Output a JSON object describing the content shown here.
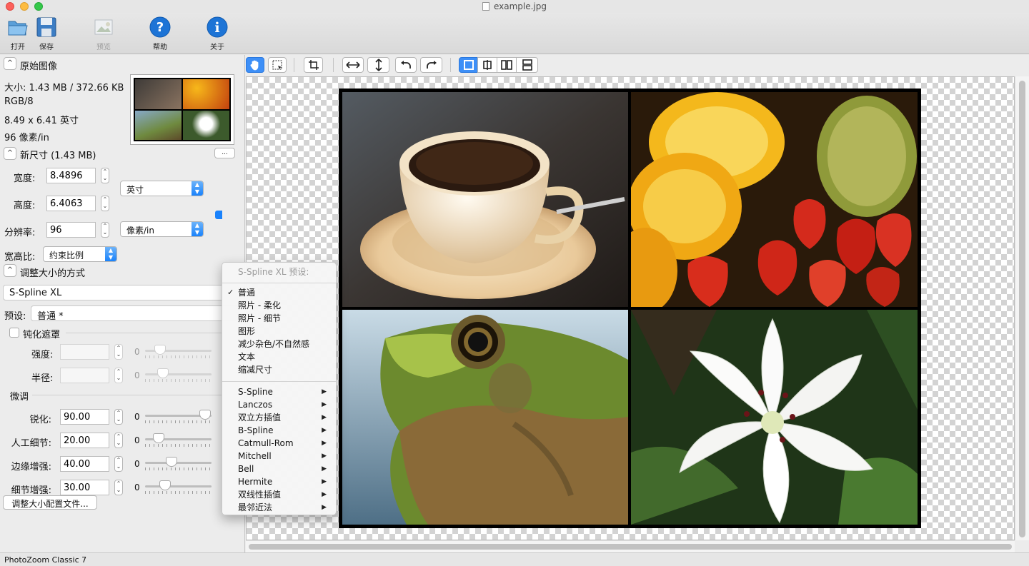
{
  "window": {
    "title": "example.jpg"
  },
  "toolbar": {
    "open": "打开",
    "save": "保存",
    "preview": "预览",
    "help": "帮助",
    "about": "关于"
  },
  "original": {
    "header": "原始图像",
    "size": "大小: 1.43 MB / 372.66 KB",
    "mode": "RGB/8",
    "dims": "8.49 x 6.41 英寸",
    "res": "96 像素/in"
  },
  "new_size": {
    "header": "新尺寸 (1.43 MB)",
    "more_button": "...",
    "width_label": "宽度:",
    "width_value": "8.4896",
    "height_label": "高度:",
    "height_value": "6.4063",
    "unit": "英寸",
    "res_label": "分辨率:",
    "res_value": "96",
    "res_unit": "像素/in",
    "aspect_label": "宽高比:",
    "aspect_value": "约束比例"
  },
  "resize_method": {
    "header": "调整大小的方式",
    "method": "S-Spline XL",
    "preset_label": "预设:",
    "preset_value": "普通 *"
  },
  "unsharp": {
    "header": "钝化遮罩",
    "strength_label": "强度:",
    "radius_label": "半径:",
    "zero_a": "0",
    "zero_b": "0"
  },
  "fine_tune": {
    "header": "微调",
    "rows": [
      {
        "label": "锐化:",
        "value": "90.00",
        "min": "0",
        "level": 0.9
      },
      {
        "label": "人工细节:",
        "value": "20.00",
        "min": "0",
        "level": 0.2
      },
      {
        "label": "边缘增强:",
        "value": "40.00",
        "min": "0",
        "level": 0.4
      },
      {
        "label": "细节增强:",
        "value": "30.00",
        "min": "0",
        "level": 0.3
      }
    ],
    "profile_button": "调整大小配置文件..."
  },
  "menu": {
    "header": "S-Spline XL 预设:",
    "presets": [
      "普通",
      "照片 - 柔化",
      "照片 - 细节",
      "图形",
      "减少杂色/不自然感",
      "文本",
      "缩减尺寸"
    ],
    "checked_index": 0,
    "submenus": [
      "S-Spline",
      "Lanczos",
      "双立方插值",
      "B-Spline",
      "Catmull-Rom",
      "Mitchell",
      "Bell",
      "Hermite",
      "双线性插值",
      "最邻近法"
    ]
  },
  "status": {
    "text": "PhotoZoom Classic 7"
  },
  "colors": {
    "accent": "#1a82fb"
  }
}
